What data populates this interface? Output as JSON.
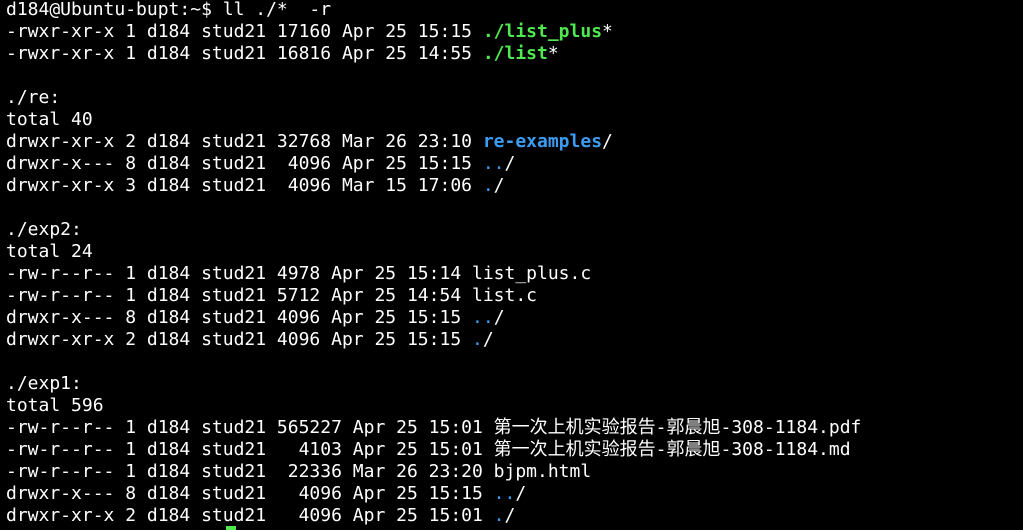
{
  "terminal": {
    "lines": [
      [
        {
          "t": "d184@Ubuntu-bupt:~$ ll ./*  -r",
          "c": ""
        }
      ],
      [
        {
          "t": "-rwxr-xr-x 1 d184 stud21 17160 Apr 25 15:15 ",
          "c": ""
        },
        {
          "t": "./list_plus",
          "c": "exec"
        },
        {
          "t": "*",
          "c": ""
        }
      ],
      [
        {
          "t": "-rwxr-xr-x 1 d184 stud21 16816 Apr 25 14:55 ",
          "c": ""
        },
        {
          "t": "./list",
          "c": "exec"
        },
        {
          "t": "*",
          "c": ""
        }
      ],
      [
        {
          "t": "",
          "c": ""
        }
      ],
      [
        {
          "t": "./re:",
          "c": ""
        }
      ],
      [
        {
          "t": "total 40",
          "c": ""
        }
      ],
      [
        {
          "t": "drwxr-xr-x 2 d184 stud21 32768 Mar 26 23:10 ",
          "c": ""
        },
        {
          "t": "re-examples",
          "c": "dir"
        },
        {
          "t": "/",
          "c": ""
        }
      ],
      [
        {
          "t": "drwxr-x--- 8 d184 stud21  4096 Apr 25 15:15 ",
          "c": ""
        },
        {
          "t": "..",
          "c": "dirdot"
        },
        {
          "t": "/",
          "c": ""
        }
      ],
      [
        {
          "t": "drwxr-xr-x 3 d184 stud21  4096 Mar 15 17:06 ",
          "c": ""
        },
        {
          "t": ".",
          "c": "dirdot"
        },
        {
          "t": "/",
          "c": ""
        }
      ],
      [
        {
          "t": "",
          "c": ""
        }
      ],
      [
        {
          "t": "./exp2:",
          "c": ""
        }
      ],
      [
        {
          "t": "total 24",
          "c": ""
        }
      ],
      [
        {
          "t": "-rw-r--r-- 1 d184 stud21 4978 Apr 25 15:14 list_plus.c",
          "c": ""
        }
      ],
      [
        {
          "t": "-rw-r--r-- 1 d184 stud21 5712 Apr 25 14:54 list.c",
          "c": ""
        }
      ],
      [
        {
          "t": "drwxr-x--- 8 d184 stud21 4096 Apr 25 15:15 ",
          "c": ""
        },
        {
          "t": "..",
          "c": "dirdot"
        },
        {
          "t": "/",
          "c": ""
        }
      ],
      [
        {
          "t": "drwxr-xr-x 2 d184 stud21 4096 Apr 25 15:15 ",
          "c": ""
        },
        {
          "t": ".",
          "c": "dirdot"
        },
        {
          "t": "/",
          "c": ""
        }
      ],
      [
        {
          "t": "",
          "c": ""
        }
      ],
      [
        {
          "t": "./exp1:",
          "c": ""
        }
      ],
      [
        {
          "t": "total 596",
          "c": ""
        }
      ],
      [
        {
          "t": "-rw-r--r-- 1 d184 stud21 565227 Apr 25 15:01 第一次上机实验报告-郭晨旭-308-1184.pdf",
          "c": ""
        }
      ],
      [
        {
          "t": "-rw-r--r-- 1 d184 stud21   4103 Apr 25 15:01 第一次上机实验报告-郭晨旭-308-1184.md",
          "c": ""
        }
      ],
      [
        {
          "t": "-rw-r--r-- 1 d184 stud21  22336 Mar 26 23:20 bjpm.html",
          "c": ""
        }
      ],
      [
        {
          "t": "drwxr-x--- 8 d184 stud21   4096 Apr 25 15:15 ",
          "c": ""
        },
        {
          "t": "..",
          "c": "dirdot"
        },
        {
          "t": "/",
          "c": ""
        }
      ],
      [
        {
          "t": "drwxr-xr-x 2 d184 stud21   4096 Apr 25 15:01 ",
          "c": ""
        },
        {
          "t": ".",
          "c": "dirdot"
        },
        {
          "t": "/",
          "c": ""
        }
      ]
    ],
    "colors": {
      "background": "#000000",
      "text": "#ffffff",
      "executable": "#4ee94e",
      "directory": "#3b9cf2",
      "cursor": "#4ee94e"
    }
  }
}
